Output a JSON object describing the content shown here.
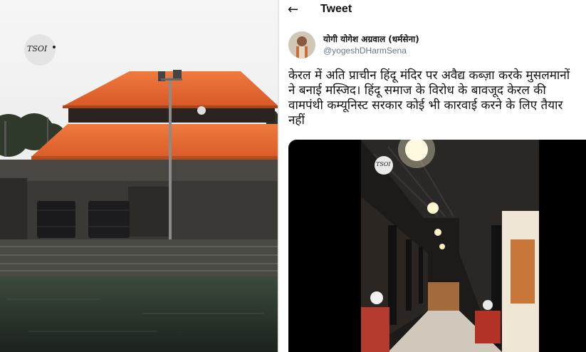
{
  "left_photo": {
    "watermark": "TSOI",
    "description_icon": "temple-photo"
  },
  "tweet": {
    "header": {
      "back_icon": "left-arrow-icon",
      "back_glyph": "←",
      "title": "Tweet"
    },
    "author": {
      "name": "योगी योगेश अग्रवाल (धर्मसेना)",
      "handle": "@yogeshDHarmSena"
    },
    "text_lines": [
      "केरल में अति प्राचीन हिंदू मंदिर पर अवैद्य कब्ज़ा करके मुसलमानों",
      "ने बनाई मस्जिद। हिंदू समाज के विरोध के बावजूद केरल की",
      "वामपंथी कम्यूनिस्ट सरकार कोई भी कारवाई करने के लिए तैयार",
      "नहीं"
    ],
    "media": {
      "watermark": "TSOI"
    }
  },
  "colors": {
    "roof": "#e8682f",
    "handle": "#657786",
    "text": "#111111"
  }
}
